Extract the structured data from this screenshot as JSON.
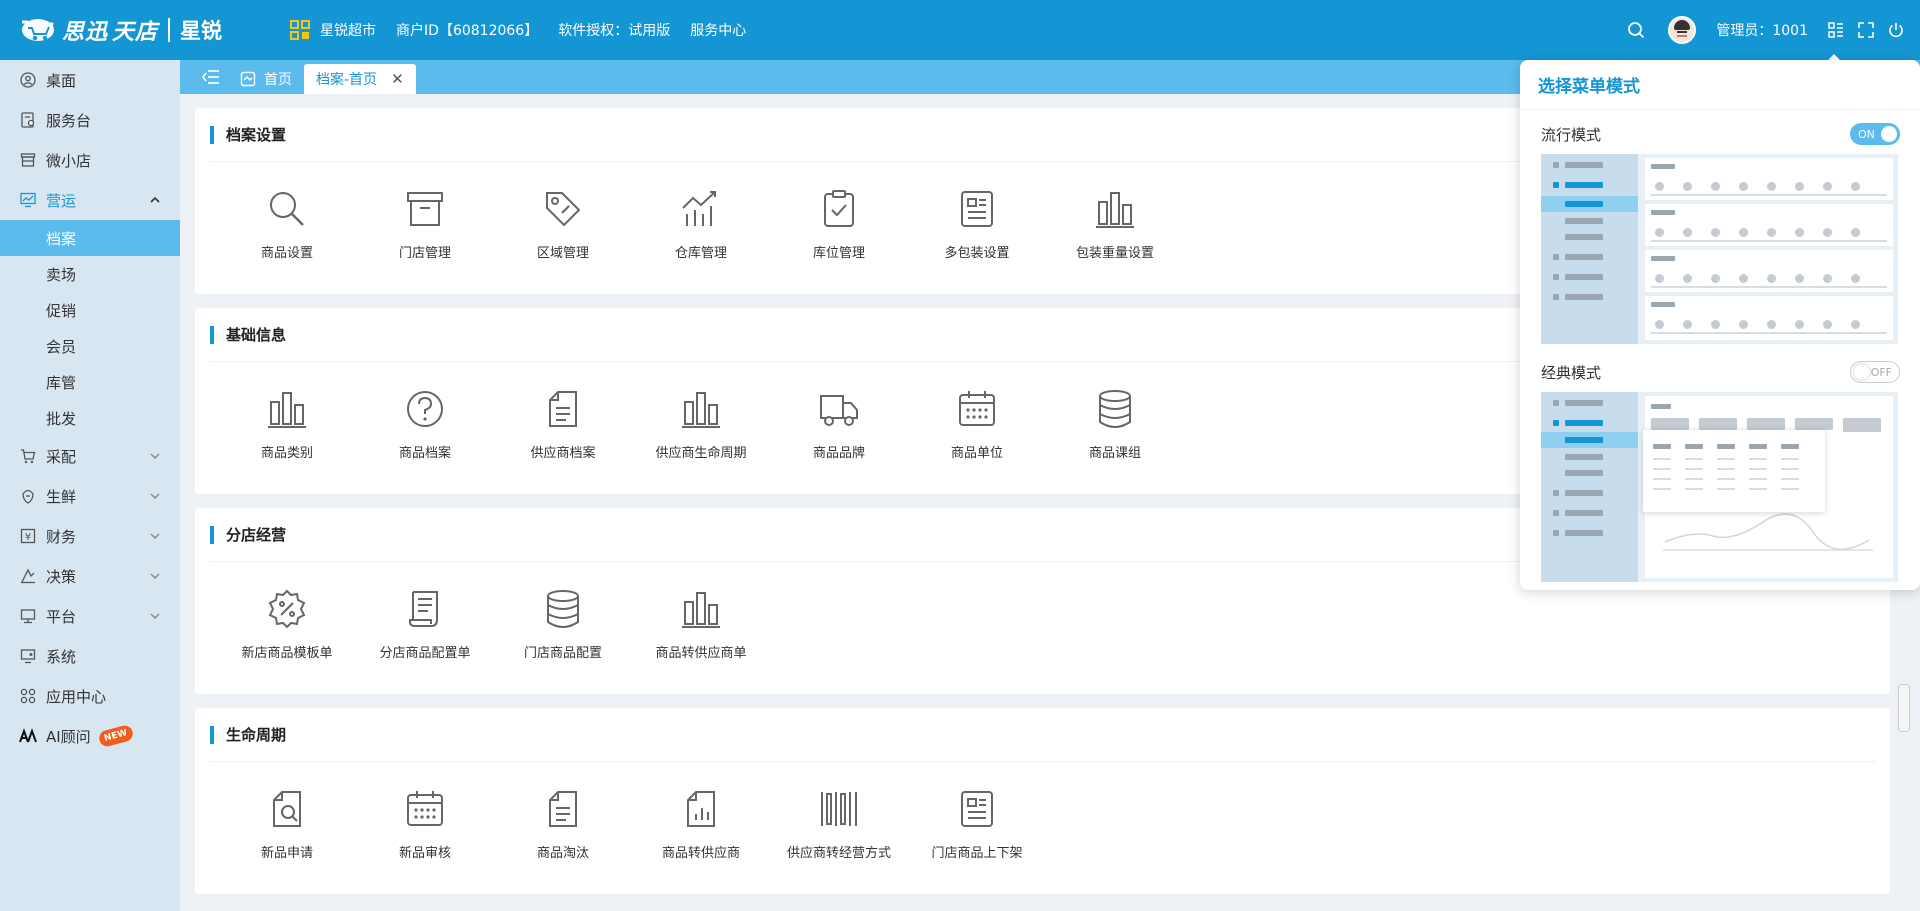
{
  "header": {
    "brand": "思迅",
    "brand2": "天店",
    "product": "星锐",
    "shop_name": "星锐超市",
    "merchant_id": "商户ID【60812066】",
    "license": "软件授权：试用版",
    "service_center": "服务中心",
    "admin": "管理员：1001"
  },
  "sidebar": {
    "items": [
      {
        "label": "桌面",
        "icon": "desktop-icon"
      },
      {
        "label": "服务台",
        "icon": "service-desk-icon"
      },
      {
        "label": "微小店",
        "icon": "store-icon"
      },
      {
        "label": "营运",
        "icon": "operation-icon"
      },
      {
        "label": "采配",
        "icon": "cart-icon"
      },
      {
        "label": "生鲜",
        "icon": "fresh-icon"
      },
      {
        "label": "财务",
        "icon": "finance-icon"
      },
      {
        "label": "决策",
        "icon": "decision-icon"
      },
      {
        "label": "平台",
        "icon": "platform-icon"
      },
      {
        "label": "系统",
        "icon": "system-icon"
      },
      {
        "label": "应用中心",
        "icon": "app-center-icon"
      },
      {
        "label": "AI顾问",
        "icon": "ai-icon"
      }
    ],
    "sub_items": [
      "档案",
      "卖场",
      "促销",
      "会员",
      "库管",
      "批发"
    ],
    "new_badge": "NEW"
  },
  "tabs": {
    "home": "首页",
    "active": "档案-首页"
  },
  "sections": [
    {
      "title": "档案设置",
      "items": [
        "商品设置",
        "门店管理",
        "区域管理",
        "仓库管理",
        "库位管理",
        "多包装设置",
        "包装重量设置"
      ]
    },
    {
      "title": "基础信息",
      "items": [
        "商品类别",
        "商品档案",
        "供应商档案",
        "供应商生命周期",
        "商品品牌",
        "商品单位",
        "商品课组"
      ]
    },
    {
      "title": "分店经营",
      "items": [
        "新店商品模板单",
        "分店商品配置单",
        "门店商品配置",
        "商品转供应商单"
      ]
    },
    {
      "title": "生命周期",
      "items": [
        "新品申请",
        "新品审核",
        "商品淘汰",
        "商品转供应商",
        "供应商转经营方式",
        "门店商品上下架"
      ]
    }
  ],
  "popup": {
    "title": "选择菜单模式",
    "modes": [
      {
        "label": "流行模式",
        "toggle": "ON"
      },
      {
        "label": "经典模式",
        "toggle": "OFF"
      }
    ]
  },
  "colors": {
    "primary": "#1596d4",
    "light": "#5bbbec",
    "sidebar_bg": "#d8e6f2"
  }
}
